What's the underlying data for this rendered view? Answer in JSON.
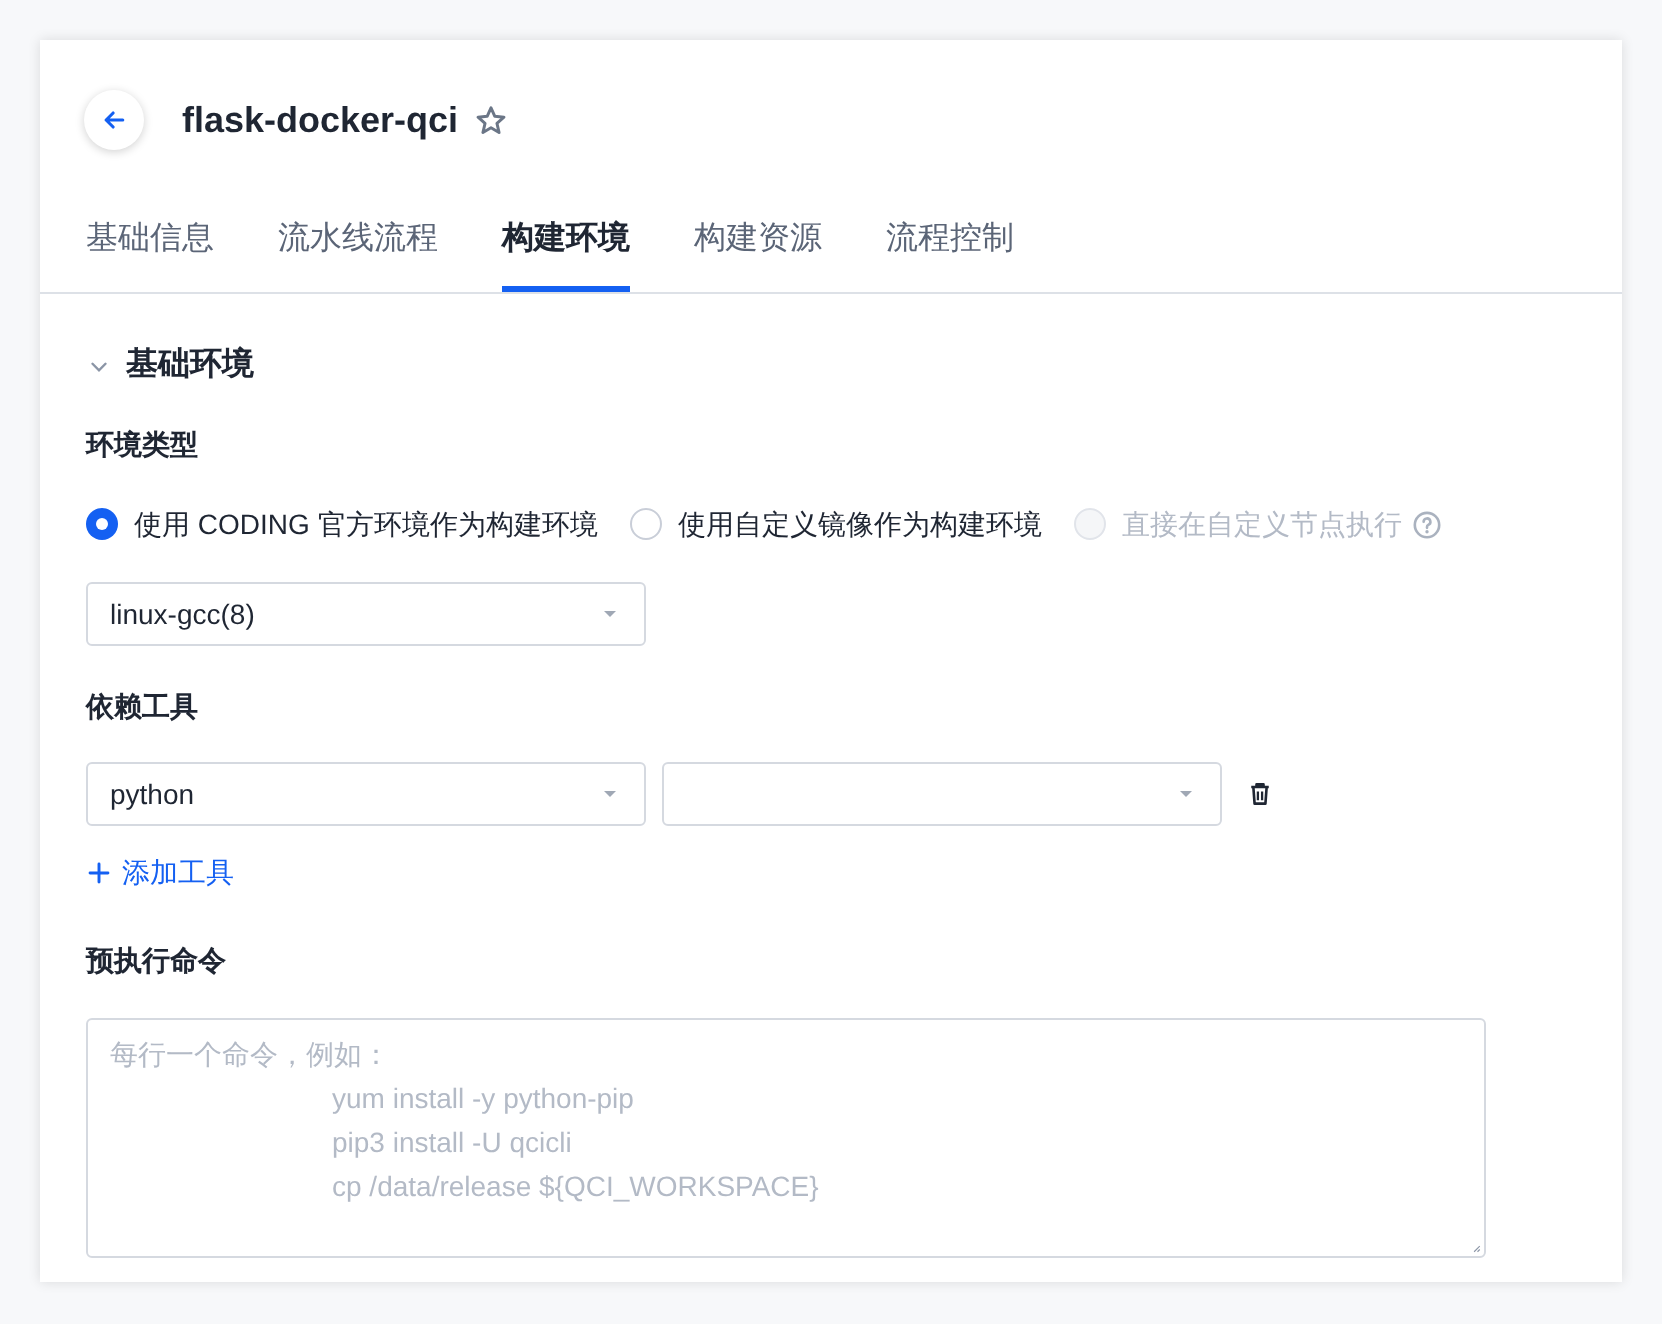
{
  "header": {
    "title": "flask-docker-qci",
    "starred": false
  },
  "tabs": [
    {
      "label": "基础信息",
      "selected": false
    },
    {
      "label": "流水线流程",
      "selected": false
    },
    {
      "label": "构建环境",
      "selected": true
    },
    {
      "label": "构建资源",
      "selected": false
    },
    {
      "label": "流程控制",
      "selected": false
    }
  ],
  "section": {
    "title": "基础环境",
    "expanded": true
  },
  "env_type": {
    "label": "环境类型",
    "options": [
      {
        "label": "使用 CODING 官方环境作为构建环境",
        "selected": true,
        "disabled": false,
        "help": false
      },
      {
        "label": "使用自定义镜像作为构建环境",
        "selected": false,
        "disabled": false,
        "help": false
      },
      {
        "label": "直接在自定义节点执行",
        "selected": false,
        "disabled": true,
        "help": true
      }
    ]
  },
  "env_select": {
    "value": "linux-gcc(8)"
  },
  "tools": {
    "label": "依赖工具",
    "rows": [
      {
        "name": "python"
      }
    ],
    "add_label": "添加工具"
  },
  "pre_command": {
    "label": "预执行命令",
    "placeholder_lines": [
      "每行一个命令，例如：",
      "yum install -y python-pip",
      "pip3 install -U qcicli",
      "cp /data/release ${QCI_WORKSPACE}"
    ]
  }
}
